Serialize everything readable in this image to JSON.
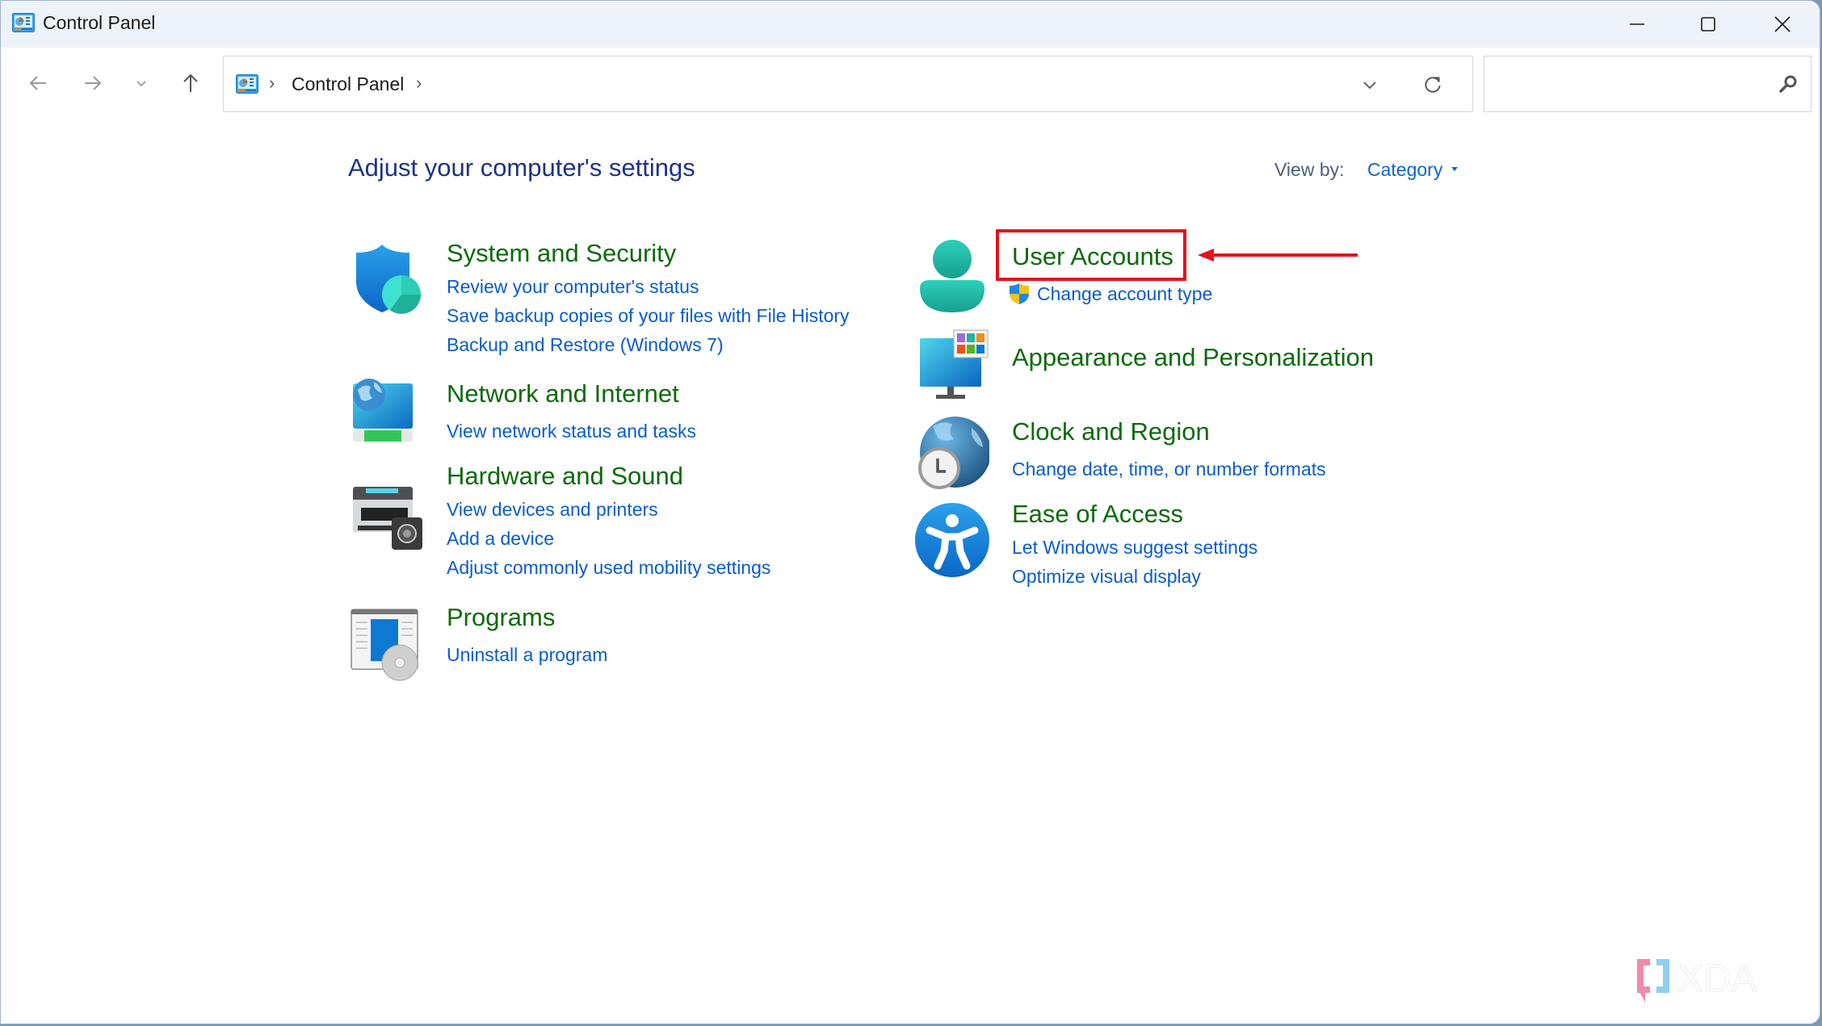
{
  "window": {
    "title": "Control Panel",
    "app_icon": "control-panel-icon",
    "controls": [
      "minimize-icon",
      "maximize-icon",
      "close-icon"
    ]
  },
  "navigation": {
    "back": "arrow-left-icon",
    "forward": "arrow-right-icon",
    "recent": "chevron-down-icon",
    "up": "arrow-up-icon",
    "breadcrumb": [
      "Control Panel"
    ],
    "address_dropdown": "chevron-down-icon",
    "refresh": "refresh-icon",
    "search_value": "",
    "search_placeholder": ""
  },
  "header": {
    "title": "Adjust your computer's settings",
    "view_by_label": "View by:",
    "view_by_value": "Category"
  },
  "categories": [
    {
      "title": "System and Security",
      "icon": "shield-icon",
      "links": [
        "Review your computer's status",
        "Save backup copies of your files with File History",
        "Backup and Restore (Windows 7)"
      ]
    },
    {
      "title": "Network and Internet",
      "icon": "network-globe-icon",
      "links": [
        "View network status and tasks"
      ]
    },
    {
      "title": "Hardware and Sound",
      "icon": "printer-speaker-icon",
      "links": [
        "View devices and printers",
        "Add a device",
        "Adjust commonly used mobility settings"
      ]
    },
    {
      "title": "Programs",
      "icon": "programs-disc-icon",
      "links": [
        "Uninstall a program"
      ]
    },
    {
      "title": "User Accounts",
      "icon": "user-icon",
      "links": [
        "Change account type"
      ],
      "link_icon": "uac-shield-icon"
    },
    {
      "title": "Appearance and Personalization",
      "icon": "monitor-palette-icon",
      "links": []
    },
    {
      "title": "Clock and Region",
      "icon": "globe-clock-icon",
      "links": [
        "Change date, time, or number formats"
      ]
    },
    {
      "title": "Ease of Access",
      "icon": "accessibility-icon",
      "links": [
        "Let Windows suggest settings",
        "Optimize visual display"
      ]
    }
  ],
  "annotation": {
    "highlight_target": "User Accounts",
    "color": "#e3121b"
  },
  "watermark": {
    "text": "XDA"
  }
}
